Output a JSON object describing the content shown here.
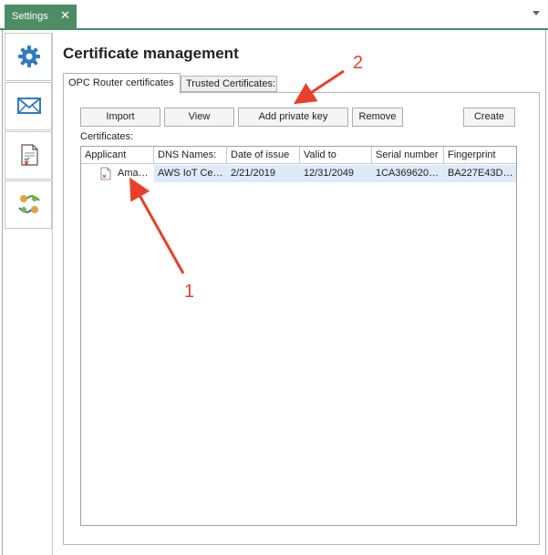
{
  "top_tab": {
    "label": "Settings",
    "close": "✕"
  },
  "nav": {
    "items": [
      {
        "name": "settings",
        "icon": "gear-icon"
      },
      {
        "name": "mail",
        "icon": "envelope-icon"
      },
      {
        "name": "certificates",
        "icon": "certificate-icon"
      },
      {
        "name": "connections",
        "icon": "connection-icon"
      }
    ],
    "active_index": 2
  },
  "page": {
    "title": "Certificate management"
  },
  "tabs": [
    {
      "label": "OPC Router certificates",
      "active": true
    },
    {
      "label": "Trusted Certificates:",
      "active": false
    }
  ],
  "buttons": {
    "import": "Import",
    "view": "View",
    "add_private_key": "Add private key",
    "remove": "Remove",
    "create": "Create"
  },
  "certificates_label": "Certificates:",
  "table": {
    "columns": [
      "Applicant",
      "DNS Names:",
      "Date of issue",
      "Valid to",
      "Serial number",
      "Fingerprint"
    ],
    "rows": [
      {
        "applicant": "Ama…",
        "dns_names": "AWS IoT Ce…",
        "date_of_issue": "2/21/2019",
        "valid_to": "12/31/2049",
        "serial_number": "1CA369620…",
        "fingerprint": "BA227E43D…"
      }
    ]
  },
  "annotations": {
    "label_1": "1",
    "label_2": "2",
    "color": "#e8402a"
  },
  "colors": {
    "accent": "#4e8d64",
    "selection": "#ddeaf7"
  }
}
